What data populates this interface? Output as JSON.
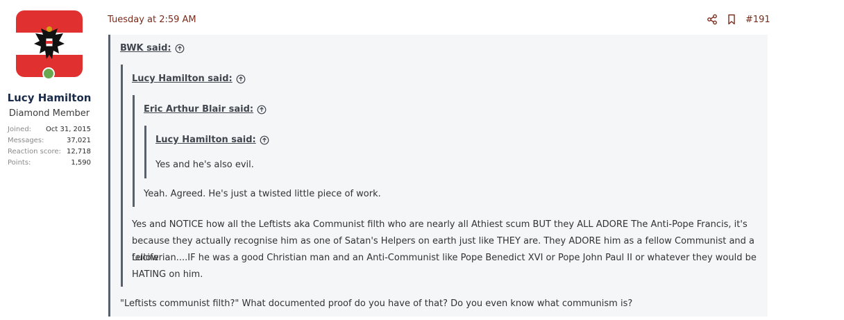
{
  "user": {
    "name": "Lucy Hamilton",
    "title": "Diamond Member",
    "stats": [
      {
        "key": "Joined:",
        "value": "Oct 31, 2015"
      },
      {
        "key": "Messages:",
        "value": "37,021"
      },
      {
        "key": "Reaction score:",
        "value": "12,718"
      },
      {
        "key": "Points:",
        "value": "1,590"
      }
    ]
  },
  "post": {
    "date": "Tuesday at 2:59 AM",
    "number": "#191"
  },
  "quotes": {
    "q1_author": "BWK said:",
    "q2_author": "Lucy Hamilton said:",
    "q3_author": "Eric Arthur Blair said:",
    "q4_author": "Lucy Hamilton said:",
    "q4_text": "Yes and he's also evil.",
    "q3_text": "Yeah. Agreed. He's just a twisted little piece of work.",
    "q2_text_lines": [
      "Yes and NOTICE how all the Leftists aka Communist filth who are nearly all Athiest scum BUT they ALL ADORE The Anti-Pope Francis, it's",
      "because they actually recognise him as one of Satan's Helpers on earth just like THEY are. They ADORE him as a fellow Communist and a fellow",
      "Luciferian....IF he was a good Christian man and an Anti-Communist like Pope Benedict XVI or Pope John Paul II or whatever they would be",
      "HATING on him."
    ],
    "q1_text": "\"Leftists communist filth?\" What documented proof do you have of that? Do you even know what communism is?"
  },
  "colors": {
    "date": "#7a2a1a",
    "quote_bar": "#5a6069",
    "avatar_red": "#e03030",
    "online": "#6aa84f"
  }
}
